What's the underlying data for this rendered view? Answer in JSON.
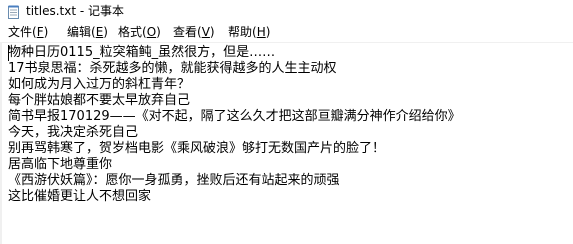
{
  "window": {
    "title": "titles.txt - 记事本",
    "icon": "notepad-icon"
  },
  "menubar": {
    "items": [
      {
        "label": "文件(",
        "mnemonic": "F",
        "suffix": ")"
      },
      {
        "label": "编辑(",
        "mnemonic": "E",
        "suffix": ")"
      },
      {
        "label": "格式(",
        "mnemonic": "O",
        "suffix": ")"
      },
      {
        "label": "查看(",
        "mnemonic": "V",
        "suffix": ")"
      },
      {
        "label": "帮助(",
        "mnemonic": "H",
        "suffix": ")"
      }
    ]
  },
  "editor": {
    "lines": [
      "物种日历0115_粒突箱鲀_虽然很方，但是……",
      "17书泉思福：杀死越多的懒，就能获得越多的人生主动权",
      "如何成为月入过万的斜杠青年？",
      "每个胖姑娘都不要太早放弃自己",
      "简书早报170129——《对不起，隔了这么久才把这部亘瓣满分神作介绍给你》",
      "今天，我决定杀死自己",
      "别再骂韩寒了，贺岁档电影《乘风破浪》够打无数国产片的脸了！",
      "居高临下地尊重你",
      "《西游伏妖篇》：愿你一身孤勇，挫败后还有站起来的顽强",
      "这比催婚更让人不想回家"
    ]
  }
}
